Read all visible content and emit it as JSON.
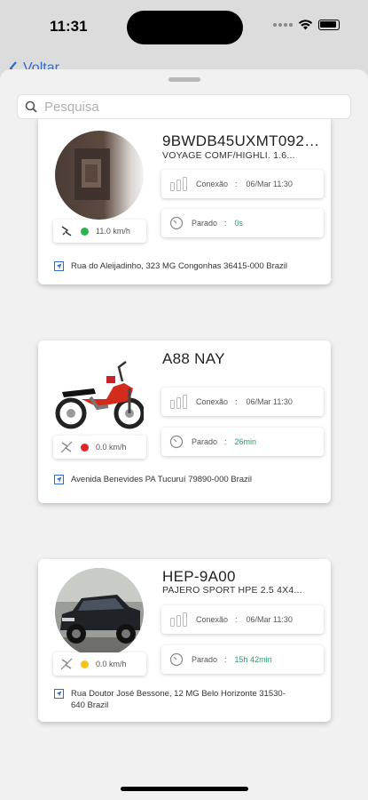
{
  "status_bar": {
    "time": "11:31"
  },
  "nav": {
    "back_label": "Voltar"
  },
  "search": {
    "placeholder": "Pesquisa"
  },
  "vehicles": [
    {
      "plate": "9BWDB45UXMT0925...",
      "model": "VOYAGE COMF/HIGHLI. 1.6...",
      "speed": "11.0 km/h",
      "speed_status_color": "#2db34a",
      "connection_label": "Conexão",
      "connection_time": "06/Mar 11:30",
      "state_label": "Parado",
      "state_duration": "0s",
      "address": "Rua do Aleijadinho, 323 MG Congonhas 36415-000 Brazil"
    },
    {
      "plate": "A88 NAY",
      "model": "",
      "speed": "0.0 km/h",
      "speed_status_color": "#e0262a",
      "connection_label": "Conexão",
      "connection_time": "06/Mar 11:30",
      "state_label": "Parado",
      "state_duration": "26min",
      "address": "Avenida Benevides PA Tucuruí 79890-000 Brazil"
    },
    {
      "plate": "HEP-9A00",
      "model": "PAJERO SPORT HPE 2.5 4X4...",
      "speed": "0.0 km/h",
      "speed_status_color": "#f4c518",
      "connection_label": "Conexão",
      "connection_time": "06/Mar 11:30",
      "state_label": "Parado",
      "state_duration": "15h 42min",
      "address": "Rua Doutor José Bessone, 12 MG Belo Horizonte 31530-640 Brazil"
    }
  ],
  "colors": {
    "accent": "#2d6ad1",
    "duration_green": "#2aa06a"
  }
}
